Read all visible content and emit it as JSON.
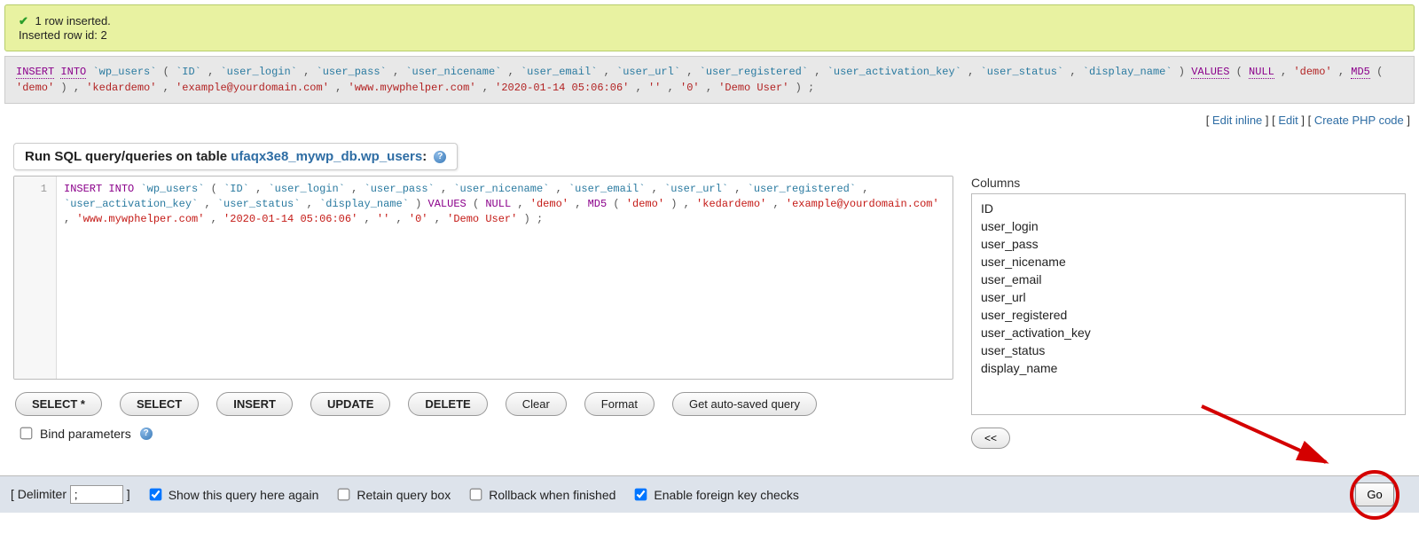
{
  "success": {
    "line1": "1 row inserted.",
    "line2": "Inserted row id: 2"
  },
  "executed_sql": "INSERT INTO `wp_users` (`ID`, `user_login`, `user_pass`, `user_nicename`, `user_email`, `user_url`, `user_registered`, `user_activation_key`, `user_status`, `display_name`) VALUES (NULL, 'demo', MD5('demo'), 'kedardemo', 'example@yourdomain.com', 'www.mywphelper.com', '2020-01-14 05:06:06', '', '0', 'Demo User');",
  "actions": {
    "edit_inline": "Edit inline",
    "edit": "Edit",
    "create_php": "Create PHP code"
  },
  "sql_tab": {
    "prefix": "Run SQL query/queries on table ",
    "table": "ufaqx3e8_mywp_db.wp_users",
    "suffix": ":"
  },
  "editor": {
    "line_no": "1",
    "content": "INSERT INTO `wp_users` (`ID`, `user_login`, `user_pass`, `user_nicename`, `user_email`, `user_url`, `user_registered`, `user_activation_key`, `user_status`, `display_name`) VALUES (NULL, 'demo', MD5('demo'), 'kedardemo', 'example@yourdomain.com', 'www.mywphelper.com', '2020-01-14 05:06:06', '', '0', 'Demo User');"
  },
  "buttons": {
    "select_star": "SELECT *",
    "select": "SELECT",
    "insert": "INSERT",
    "update": "UPDATE",
    "delete": "DELETE",
    "clear": "Clear",
    "format": "Format",
    "autosave": "Get auto-saved query"
  },
  "bind_label": "Bind parameters",
  "columns_header": "Columns",
  "columns": [
    "ID",
    "user_login",
    "user_pass",
    "user_nicename",
    "user_email",
    "user_url",
    "user_registered",
    "user_activation_key",
    "user_status",
    "display_name"
  ],
  "move_left": "<<",
  "bottom": {
    "delimiter_label": "Delimiter",
    "delimiter_value": ";",
    "show_again": "Show this query here again",
    "retain": "Retain query box",
    "rollback": "Rollback when finished",
    "fk": "Enable foreign key checks",
    "go": "Go"
  },
  "checked": {
    "show_again": true,
    "retain": false,
    "rollback": false,
    "fk": true,
    "bind": false
  }
}
